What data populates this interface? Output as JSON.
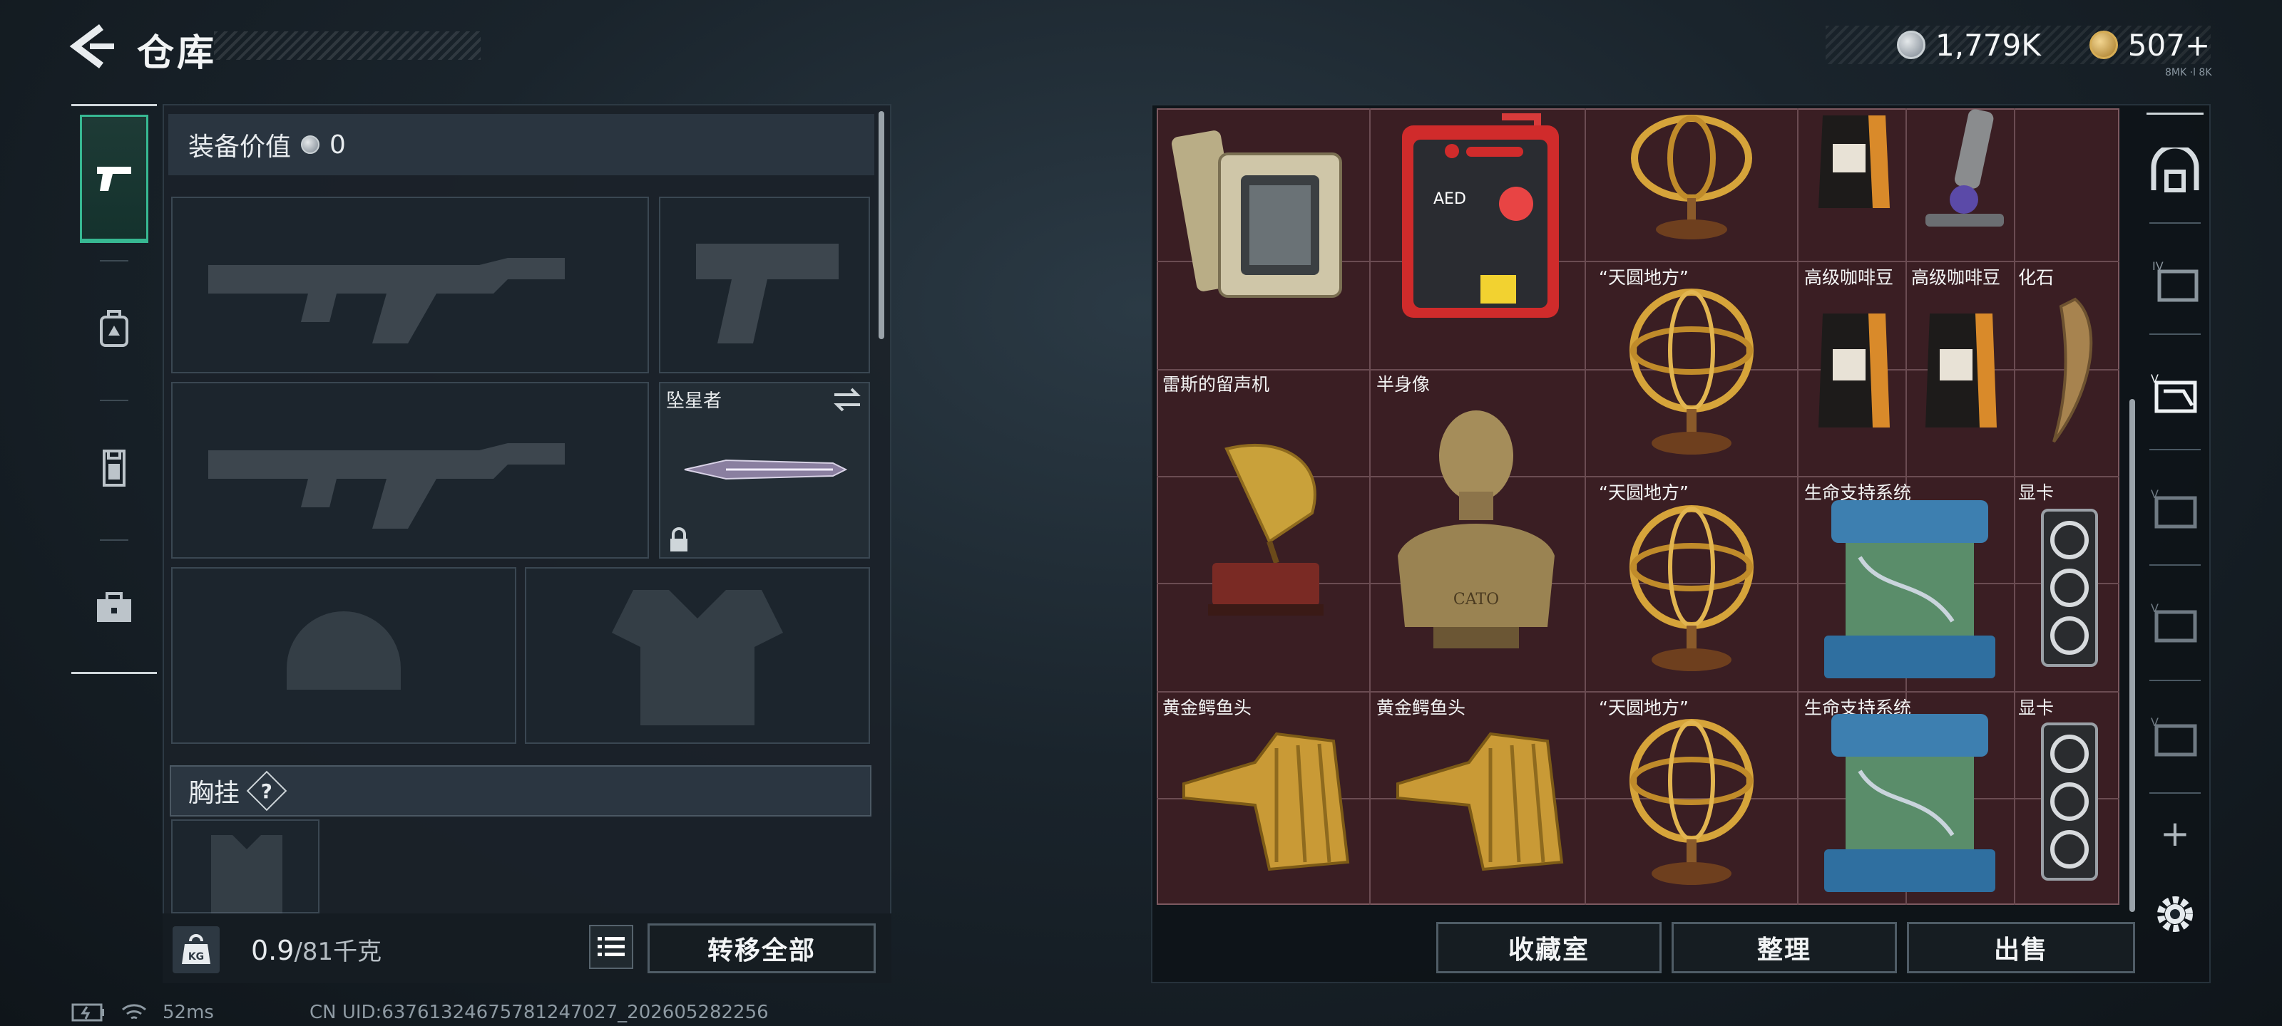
{
  "header": {
    "title": "仓库",
    "currency": [
      {
        "icon": "silver-coin-icon",
        "amount": "1,779K"
      },
      {
        "icon": "gold-coin-icon",
        "amount": "507+"
      }
    ],
    "small_note": "8MK ·l 8K"
  },
  "left_tabs": [
    {
      "name": "weapon-tab",
      "icon": "pistol-icon",
      "active": true
    },
    {
      "name": "backpack-tab",
      "icon": "backpack-icon",
      "active": false
    },
    {
      "name": "armor-tab",
      "icon": "vest-icon",
      "active": false
    },
    {
      "name": "case-tab",
      "icon": "toolbox-icon",
      "active": false
    }
  ],
  "loadout": {
    "equip_value_label": "装备价值",
    "equip_value": "0",
    "melee_label": "坠星者",
    "chest_label": "胸挂",
    "chest_help": "?",
    "weight_current": "0.9",
    "weight_max": "/81千克",
    "weight_icon": "KG",
    "transfer_all": "转移全部"
  },
  "items": {
    "top_row": [
      "",
      "",
      "",
      "",
      ""
    ],
    "tianyuan": "“天圆地方”",
    "coffee": "高级咖啡豆",
    "fossil": "化石",
    "gramophone": "雷斯的留声机",
    "bust": "半身像",
    "bust_inscription": "CATO",
    "life_support": "生命支持系统",
    "gpu": "显卡",
    "croc": "黄金鳄鱼头",
    "aed_text": "AED"
  },
  "actions": {
    "collection": "收藏室",
    "sort": "整理",
    "sell": "出售"
  },
  "right_nav": {
    "plus": "+"
  },
  "status": {
    "ping": "52ms",
    "uid": "CN UID:637613246757812470‍27_202605282256"
  },
  "colors": {
    "accent_green": "#37b892",
    "grid_bg": "#3a1e23",
    "gold": "#d6ad55"
  }
}
